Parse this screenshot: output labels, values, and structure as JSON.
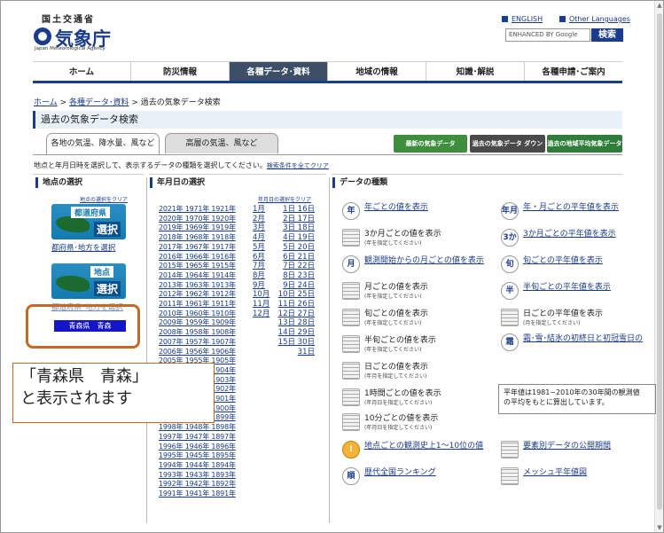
{
  "header": {
    "ministry": "国土交通省",
    "agency": "気象庁",
    "agency_en": "Japan Meteorological Agency",
    "english_link": "ENGLISH",
    "other_languages_link": "Other Languages",
    "search_placeholder": "ENHANCED BY Google",
    "search_button": "検索"
  },
  "nav": {
    "items": [
      "ホーム",
      "防災情報",
      "各種データ･資料",
      "地域の情報",
      "知識･解説",
      "各種申請･ご案内"
    ],
    "active_index": 2
  },
  "breadcrumb": {
    "home": "ホーム",
    "sep1": " > ",
    "data": "各種データ･資料",
    "sep2": " > ",
    "current": "過去の気象データ検索"
  },
  "page_title": "過去の気象データ検索",
  "tabs": [
    "各地の気温、降水量、風など",
    "高層の気温、風など"
  ],
  "banners": [
    "最新の気象データ",
    "過去の気象データ ダウンロード",
    "過去の地域平均気象データ"
  ],
  "instructions": {
    "text": "地点と年月日時を選択して、表示するデータの種類を選択してください。",
    "clear_all": "検索条件を全てクリア"
  },
  "location": {
    "heading": "地点の選択",
    "clear": "地点の選択をクリア",
    "pref_button_top": "都道府県",
    "pref_button_bottom": "選択",
    "pref_link": "都府県･地方を選択",
    "station_button_top": "地点",
    "station_button_bottom": "選択",
    "station_link": "都道府県･地方を選択",
    "selected": "青森県　青森"
  },
  "date": {
    "heading": "年月日の選択",
    "clear": "年月日の選択をクリア",
    "years": [
      "2021年 1971年 1921年",
      "2020年 1970年 1920年",
      "2019年 1969年 1919年",
      "2018年 1968年 1918年",
      "2017年 1967年 1917年",
      "2016年 1966年 1916年",
      "2015年 1965年 1915年",
      "2014年 1964年 1914年",
      "2013年 1963年 1913年",
      "2012年 1962年 1912年",
      "2011年 1961年 1911年",
      "2010年 1960年 1910年",
      "2009年 1959年 1909年",
      "2008年 1958年 1908年",
      "2007年 1957年 1907年",
      "2006年 1956年 1906年",
      "2005年 1955年 1905年",
      "2004年 1954年 1904年",
      "2003年 1953年 1903年",
      "2002年 1952年 1902年",
      "2001年 1951年 1901年",
      "2000年 1950年 1900年",
      "1999年 1949年 1899年",
      "1998年 1948年 1898年",
      "1997年 1947年 1897年",
      "1996年 1946年 1896年",
      "1995年 1945年 1895年",
      "1994年 1944年 1894年",
      "1993年 1943年 1893年",
      "1992年 1942年 1892年",
      "1991年 1941年 1891年"
    ],
    "months": [
      "1月",
      "2月",
      "3月",
      "4月",
      "5月",
      "6月",
      "7月",
      "8月",
      "9月",
      "10月",
      "11月",
      "12月"
    ],
    "days": [
      "1日 16日",
      "2日 17日",
      "3日 18日",
      "4日 19日",
      "5日 20日",
      "6日 21日",
      "7日 22日",
      "8日 23日",
      "9日 24日",
      "10日 25日",
      "11日 26日",
      "12日 27日",
      "13日 28日",
      "14日 29日",
      "15日 30日",
      "31日"
    ]
  },
  "datatype": {
    "heading": "データの種類",
    "left": [
      {
        "icon": "年",
        "label": "年ごとの値を表示",
        "sub": "",
        "link": true
      },
      {
        "icon": "",
        "label": "3か月ごとの値を表示",
        "sub": "(年を指定してください)",
        "link": false
      },
      {
        "icon": "月",
        "label": "観測開始からの月ごとの値を表示",
        "sub": "",
        "link": true
      },
      {
        "icon": "",
        "label": "月ごとの値を表示",
        "sub": "(年を指定してください)",
        "link": false
      },
      {
        "icon": "",
        "label": "旬ごとの値を表示",
        "sub": "(年を指定してください)",
        "link": false
      },
      {
        "icon": "",
        "label": "半旬ごとの値を表示",
        "sub": "(年を指定してください)",
        "link": false
      },
      {
        "icon": "",
        "label": "日ごとの値を表示",
        "sub": "(年月を指定してください)",
        "link": false
      },
      {
        "icon": "",
        "label": "1時間ごとの値を表示",
        "sub": "(年月日を指定してください)",
        "link": false
      },
      {
        "icon": "",
        "label": "10分ごとの値を表示",
        "sub": "(年月日を指定してください)",
        "link": false
      },
      {
        "icon": "!",
        "label": "地点ごとの観測史上1～10位の値",
        "sub": "",
        "link": true
      },
      {
        "icon": "順",
        "label": "歴代全国ランキング",
        "sub": "",
        "link": true
      }
    ],
    "right": [
      {
        "icon": "年月",
        "label": "年・月ごとの平年値を表示",
        "sub": "",
        "link": true
      },
      {
        "icon": "3か",
        "label": "3か月ごとの平年値を表示",
        "sub": "",
        "link": true
      },
      {
        "icon": "旬",
        "label": "旬ごとの平年値を表示",
        "sub": "",
        "link": true
      },
      {
        "icon": "半",
        "label": "半旬ごとの平年値を表示",
        "sub": "",
        "link": true
      },
      {
        "icon": "",
        "label": "日ごとの平年値を表示",
        "sub": "(月を指定してください)",
        "link": false
      },
      {
        "icon": "霜",
        "label": "霜･雪･結氷の初終日と初冠雪日の",
        "sub": "",
        "link": true
      },
      {
        "icon": "",
        "label": "要素別データの公開期間",
        "sub": "",
        "link": true
      },
      {
        "icon": "",
        "label": "メッシュ平年値図",
        "sub": "",
        "link": true
      }
    ],
    "note": [
      "平年値は1981~2010年の30年間の観測値",
      "の平均をもとに算出しています。"
    ]
  },
  "annotation": [
    "「青森県　青森」",
    "と表示されます"
  ]
}
